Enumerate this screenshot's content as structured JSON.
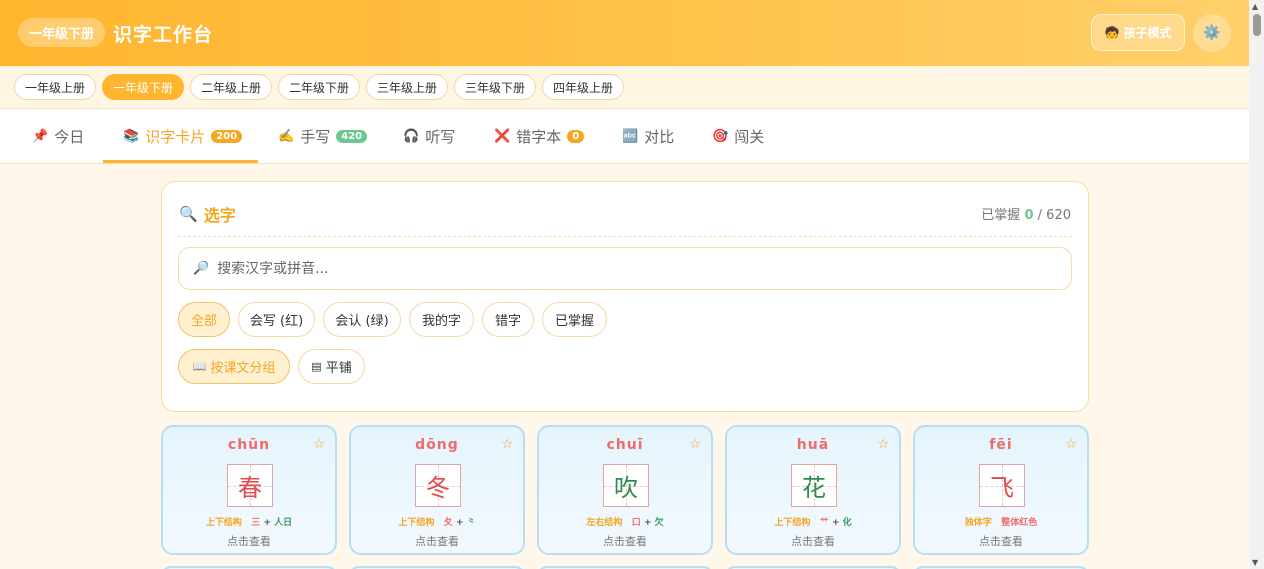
{
  "header": {
    "grade_pill": "一年级下册",
    "title": "识字工作台",
    "kid_mode_label": "孩子模式",
    "kid_mode_icon": "🧒",
    "settings_icon": "⚙️"
  },
  "grades": [
    {
      "label": "一年级上册",
      "active": false
    },
    {
      "label": "一年级下册",
      "active": true
    },
    {
      "label": "二年级上册",
      "active": false
    },
    {
      "label": "二年级下册",
      "active": false
    },
    {
      "label": "三年级上册",
      "active": false
    },
    {
      "label": "三年级下册",
      "active": false
    },
    {
      "label": "四年级上册",
      "active": false
    }
  ],
  "tabs": [
    {
      "icon": "📌",
      "label": "今日",
      "badge": ""
    },
    {
      "icon": "📚",
      "label": "识字卡片",
      "badge": "200"
    },
    {
      "icon": "✍️",
      "label": "手写",
      "badge": "420"
    },
    {
      "icon": "🎧",
      "label": "听写",
      "badge": ""
    },
    {
      "icon": "❌",
      "label": "错字本",
      "badge": "0"
    },
    {
      "icon": "🔤",
      "label": "对比",
      "badge": ""
    },
    {
      "icon": "🎯",
      "label": "闯关",
      "badge": ""
    }
  ],
  "panel": {
    "title_icon": "🔍",
    "title": "选字",
    "mastery_label": "已掌握",
    "mastery_count": "0",
    "mastery_sep": "/",
    "mastery_total": "620",
    "search_icon": "🔎",
    "search_placeholder": "搜索汉字或拼音...",
    "filters": [
      "全部",
      "会写 (红)",
      "会认 (绿)",
      "我的字",
      "错字",
      "已掌握"
    ],
    "views": [
      {
        "icon": "📖",
        "label": "按课文分组"
      },
      {
        "icon": "▤",
        "label": "平铺"
      }
    ]
  },
  "cards": [
    {
      "pinyin": "chūn",
      "char": "春",
      "char_color": "#e24b4b",
      "structure": "上下结构",
      "p1": "三",
      "plus": "+",
      "p2": "人日",
      "hint": "点击查看",
      "star": "☆"
    },
    {
      "pinyin": "dōng",
      "char": "冬",
      "char_color": "#e24b4b",
      "structure": "上下结构",
      "p1": "夂",
      "plus": "+",
      "p2": "⺀",
      "hint": "点击查看",
      "star": "☆"
    },
    {
      "pinyin": "chuī",
      "char": "吹",
      "char_color": "#2e8b4f",
      "structure": "左右结构",
      "p1": "口",
      "plus": "+",
      "p2": "欠",
      "hint": "点击查看",
      "star": "☆"
    },
    {
      "pinyin": "huā",
      "char": "花",
      "char_color": "#2e8b4f",
      "structure": "上下结构",
      "p1": "艹",
      "plus": "+",
      "p2": "化",
      "hint": "点击查看",
      "star": "☆"
    },
    {
      "pinyin": "fēi",
      "char": "飞",
      "char_color": "#e24b4b",
      "structure": "独体字",
      "p1": "整体红色",
      "plus": "",
      "p2": "",
      "hint": "点击查看",
      "star": "☆"
    }
  ],
  "colors": {
    "accent": "#ffb52e",
    "accent_text": "#f5a623",
    "write_red": "#e24b4b",
    "read_green": "#2e8b4f"
  }
}
